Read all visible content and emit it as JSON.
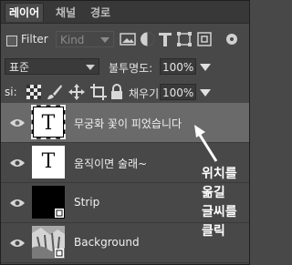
{
  "tabs": [
    {
      "label": "레이어",
      "active": true
    },
    {
      "label": "채널",
      "active": false
    },
    {
      "label": "경로",
      "active": false
    }
  ],
  "filter": {
    "label": "Filter",
    "kind_value": "Kind"
  },
  "blend": {
    "mode": "표준",
    "opacity_label": "불투명도:",
    "opacity_value": "100%"
  },
  "lock": {
    "label": "si:",
    "fill_label": "채우기:",
    "fill_value": "100%"
  },
  "layers": [
    {
      "name": "무궁화 꽃이 피었습니다",
      "thumb": "T",
      "selected": true
    },
    {
      "name": "움직이면 술래~",
      "thumb": "T",
      "selected": false
    },
    {
      "name": "Strip",
      "thumb": "black",
      "selected": false
    },
    {
      "name": "Background",
      "thumb": "photo",
      "selected": false
    }
  ],
  "annotation": {
    "line1": "위치를",
    "line2": "옮길",
    "line3": "글씨를",
    "line4": "클릭"
  },
  "colors": {
    "panel": "#484848",
    "selected_row": "#6a6a6a",
    "tabbar": "#383838"
  }
}
